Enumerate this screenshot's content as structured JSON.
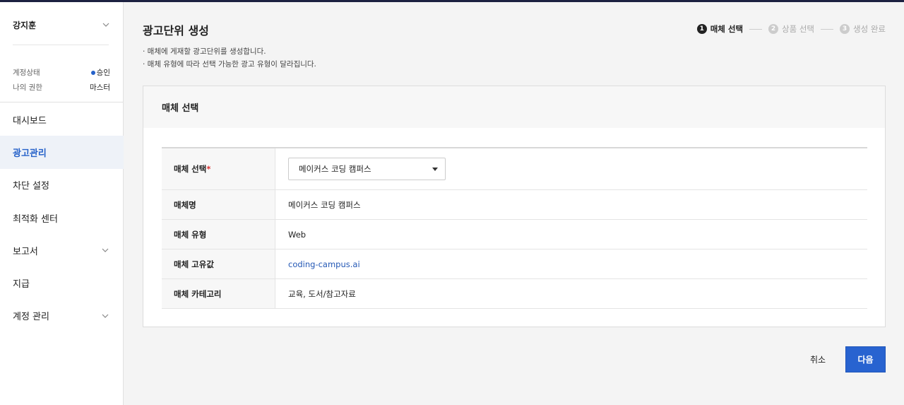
{
  "sidebar": {
    "user_name": "강지훈",
    "account_status_label": "계정상태",
    "account_status_value": "승인",
    "role_label": "나의 권한",
    "role_value": "마스터",
    "items": [
      {
        "label": "대시보드",
        "has_chevron": false,
        "active": false
      },
      {
        "label": "광고관리",
        "has_chevron": false,
        "active": true
      },
      {
        "label": "차단 설정",
        "has_chevron": false,
        "active": false
      },
      {
        "label": "최적화 센터",
        "has_chevron": false,
        "active": false
      },
      {
        "label": "보고서",
        "has_chevron": true,
        "active": false
      },
      {
        "label": "지급",
        "has_chevron": false,
        "active": false
      },
      {
        "label": "계정 관리",
        "has_chevron": true,
        "active": false
      }
    ]
  },
  "page": {
    "title": "광고단위 생성",
    "desc1": "· 매체에 게재할 광고단위를 생성합니다.",
    "desc2": "· 매체 유형에 따라 선택 가능한 광고 유형이 달라집니다."
  },
  "steps": [
    {
      "num": "1",
      "label": "매체 선택",
      "active": true
    },
    {
      "num": "2",
      "label": "상품 선택",
      "active": false
    },
    {
      "num": "3",
      "label": "생성 완료",
      "active": false
    }
  ],
  "card": {
    "title": "매체 선택",
    "rows": {
      "select_label": "매체 선택",
      "required_mark": "*",
      "select_value": "메이커스 코딩 캠퍼스",
      "name_label": "매체명",
      "name_value": "메이커스 코딩 캠퍼스",
      "type_label": "매체 유형",
      "type_value": "Web",
      "id_label": "매체 고유값",
      "id_value": "coding-campus.ai",
      "category_label": "매체 카테고리",
      "category_value": "교육, 도서/참고자료"
    }
  },
  "buttons": {
    "cancel": "취소",
    "next": "다음"
  },
  "colors": {
    "accent": "#2863d0",
    "active_nav_bg": "#eef2f8",
    "topbar": "#1c2141",
    "link": "#2458b5",
    "required": "#d33333"
  }
}
